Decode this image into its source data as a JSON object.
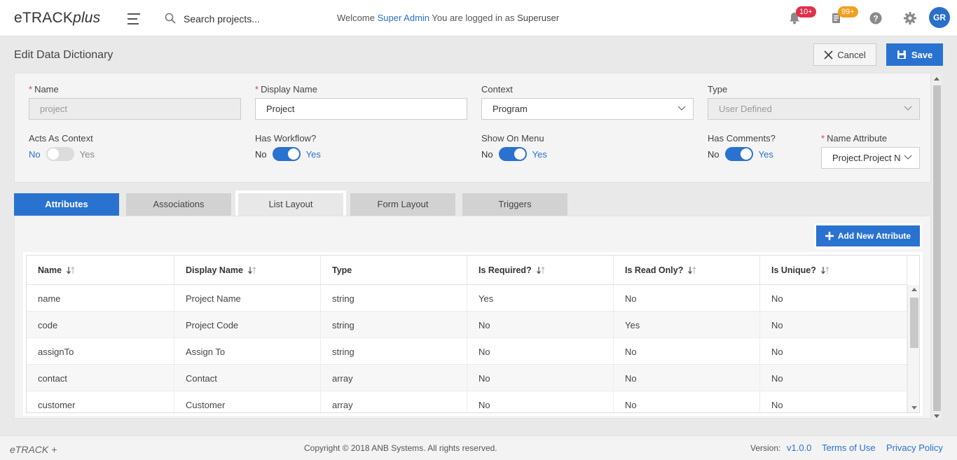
{
  "app": {
    "logo_main": "eTRACK",
    "logo_plus": "plus"
  },
  "header": {
    "search_placeholder": "Search projects...",
    "welcome_prefix": "Welcome",
    "user_name": "Super Admin",
    "logged_in_text": "You are logged in as",
    "role": "Superuser",
    "notifications_badge": "10+",
    "tasks_badge": "99+",
    "avatar_initials": "GR",
    "badge_red": "#e0304a",
    "badge_orange": "#f0a020"
  },
  "page": {
    "title": "Edit Data Dictionary",
    "cancel_label": "Cancel",
    "save_label": "Save"
  },
  "form": {
    "name_label": "Name",
    "name_value": "project",
    "display_name_label": "Display Name",
    "display_name_value": "Project",
    "context_label": "Context",
    "context_value": "Program",
    "type_label": "Type",
    "type_value": "User Defined",
    "acts_as_context_label": "Acts As Context",
    "acts_as_context": {
      "no": "No",
      "yes": "Yes",
      "on": false
    },
    "has_workflow_label": "Has Workflow?",
    "has_workflow": {
      "no": "No",
      "yes": "Yes",
      "on": true
    },
    "show_on_menu_label": "Show On Menu",
    "show_on_menu": {
      "no": "No",
      "yes": "Yes",
      "on": true
    },
    "has_comments_label": "Has Comments?",
    "has_comments": {
      "no": "No",
      "yes": "Yes",
      "on": true
    },
    "name_attribute_label": "Name Attribute",
    "name_attribute_value": "Project.Project N"
  },
  "tabs": [
    {
      "label": "Attributes"
    },
    {
      "label": "Associations"
    },
    {
      "label": "List Layout"
    },
    {
      "label": "Form Layout"
    },
    {
      "label": "Triggers"
    }
  ],
  "attributes": {
    "add_button_label": "Add New Attribute",
    "columns": [
      "Name",
      "Display Name",
      "Type",
      "Is Required?",
      "Is Read Only?",
      "Is Unique?"
    ],
    "rows": [
      [
        "name",
        "Project Name",
        "string",
        "Yes",
        "No",
        "No"
      ],
      [
        "code",
        "Project Code",
        "string",
        "No",
        "Yes",
        "No"
      ],
      [
        "assignTo",
        "Assign To",
        "string",
        "No",
        "No",
        "No"
      ],
      [
        "contact",
        "Contact",
        "array",
        "No",
        "No",
        "No"
      ],
      [
        "customer",
        "Customer",
        "array",
        "No",
        "No",
        "No"
      ]
    ]
  },
  "footer": {
    "logo": "eTRACK +",
    "copyright": "Copyright © 2018 ANB Systems. All rights reserved.",
    "version_label": "Version:",
    "version": "v1.0.0",
    "terms": "Terms of Use",
    "privacy": "Privacy Policy"
  }
}
